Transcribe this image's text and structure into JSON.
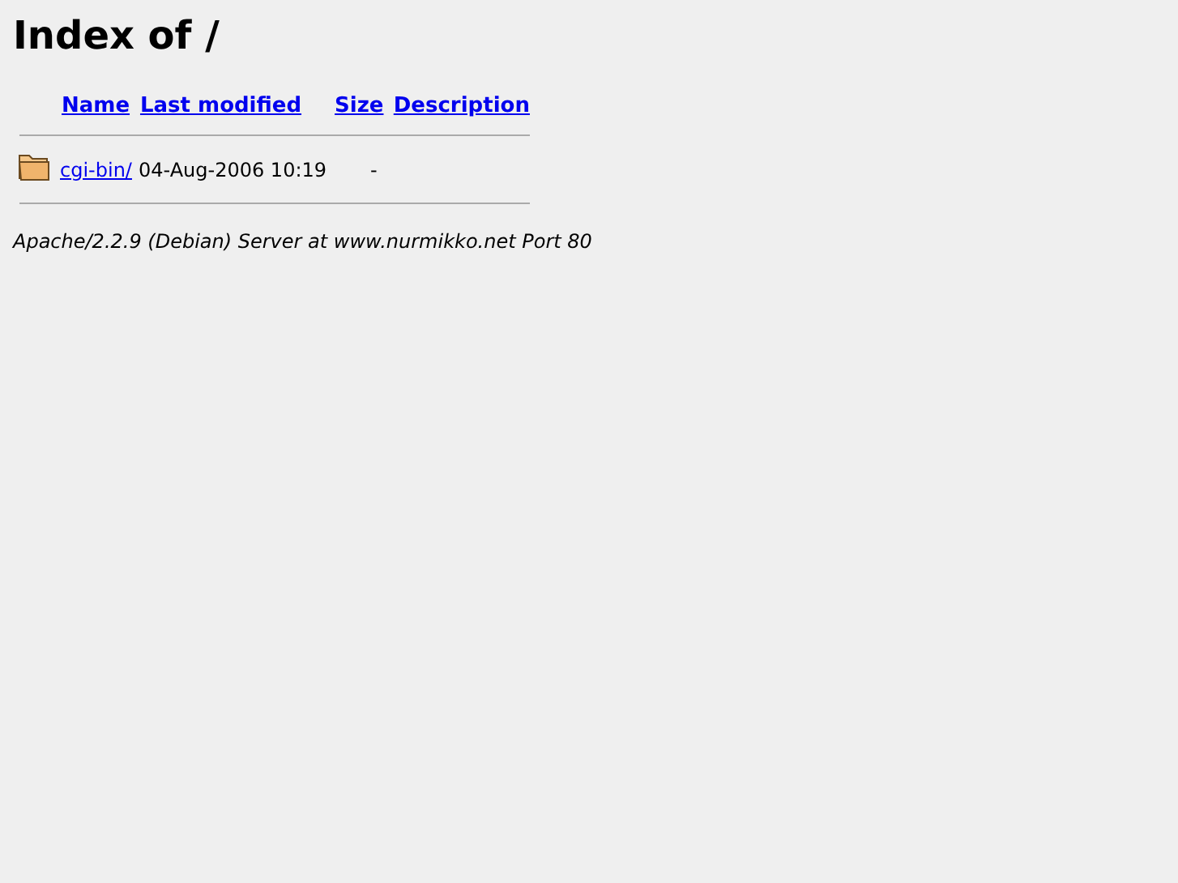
{
  "title": "Index of /",
  "columns": [
    "Name",
    "Last modified",
    "Size",
    "Description"
  ],
  "rows": [
    {
      "kind": "folder",
      "name": "cgi-bin/",
      "modified": "04-Aug-2006 10:19",
      "size": "-",
      "description": ""
    }
  ],
  "footer": "Apache/2.2.9 (Debian) Server at www.nurmikko.net Port 80"
}
